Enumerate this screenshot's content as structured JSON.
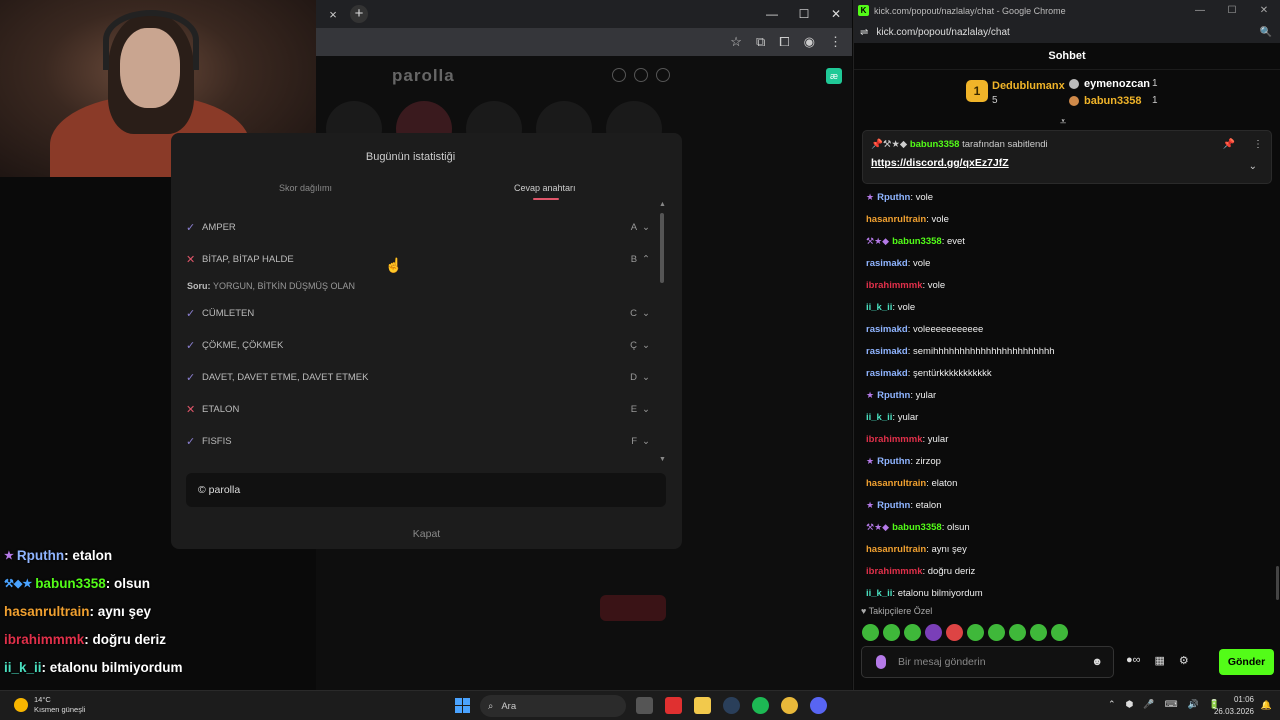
{
  "left_browser": {
    "close_tab_label": "×",
    "new_tab_label": "+",
    "win_minimize": "—",
    "win_maximize": "☐",
    "win_close": "✕",
    "addr_icons": [
      "☆",
      "⧉",
      "⧠",
      "◉",
      "⋮"
    ],
    "site_logo": "parolla",
    "ext_badge": "æ"
  },
  "modal": {
    "title": "Bugünün istatistiği",
    "tabs": [
      "Skor dağılımı",
      "Cevap anahtarı"
    ],
    "active_tab": "Cevap anahtarı",
    "answers": [
      {
        "status": "ok",
        "mark": "✓",
        "word": "AMPER",
        "letter": "A",
        "chevron": "⌄"
      },
      {
        "status": "bad",
        "mark": "✕",
        "word": "BİTAP, BİTAP HALDE",
        "letter": "B",
        "chevron": "⌃"
      },
      {
        "status": "ok",
        "mark": "✓",
        "word": "CÜMLETEN",
        "letter": "C",
        "chevron": "⌄"
      },
      {
        "status": "ok",
        "mark": "✓",
        "word": "ÇÖKME, ÇÖKMEK",
        "letter": "Ç",
        "chevron": "⌄"
      },
      {
        "status": "ok",
        "mark": "✓",
        "word": "DAVET, DAVET ETME, DAVET ETMEK",
        "letter": "D",
        "chevron": "⌄"
      },
      {
        "status": "bad",
        "mark": "✕",
        "word": "ETALON",
        "letter": "E",
        "chevron": "⌄"
      },
      {
        "status": "ok",
        "mark": "✓",
        "word": "FISFIS",
        "letter": "F",
        "chevron": "⌄"
      }
    ],
    "question_label": "Soru:",
    "question_text": "YORGUN, BİTKİN DÜŞMÜŞ OLAN",
    "copyright": "© parolla",
    "close_label": "Kapat",
    "scroll_up": "▲",
    "scroll_down": "▼"
  },
  "overlay_chat": [
    {
      "badge": "★",
      "user": "Rputhn",
      "text": " : etalon",
      "color": "#8fb4ff"
    },
    {
      "badge": "⚒◆★",
      "user": "babun3358",
      "text": " : olsun",
      "color": "#53fc18"
    },
    {
      "badge": "",
      "user": "hasanrultrain",
      "text": " : aynı şey",
      "color": "#f0a030"
    },
    {
      "badge": "",
      "user": "ibrahimmmk",
      "text": " : doğru deriz",
      "color": "#e0304a"
    },
    {
      "badge": "",
      "user": "ii_k_ii",
      "text": " : etalonu bilmiyordum",
      "color": "#4ae0c0"
    }
  ],
  "right_window": {
    "title": "kick.com/popout/nazlalay/chat - Google Chrome",
    "kick_logo": "K",
    "win_minimize": "—",
    "win_maximize": "☐",
    "win_close": "✕",
    "url": "kick.com/popout/nazlalay/chat",
    "url_icon": "⇌",
    "zoom_icon": "🔍",
    "chat_title": "Sohbet",
    "leaderboard": {
      "first": {
        "rank": "1",
        "name": "Dedublumanx",
        "count": "5"
      },
      "second": {
        "name": "eymenozcan",
        "count": "1"
      },
      "third": {
        "name": "babun3358",
        "count": "1"
      },
      "chevron": "⩡"
    },
    "pinned": {
      "by_user": "babun3358",
      "by_suffix": " tarafından sabitlendi",
      "badges": "📌⚒★◆ ",
      "link": "https://discord.gg/qxEz7JfZ",
      "pin_icon": "📌",
      "more_icon": "⋮",
      "expand_icon": "⌄"
    },
    "messages": [
      {
        "badge": "★",
        "user": "Rputhn",
        "text": ": vole",
        "color": "#8fb4ff"
      },
      {
        "badge": "",
        "user": "hasanrultrain",
        "text": ": vole",
        "color": "#f0a030"
      },
      {
        "badge": "⚒★◆",
        "user": "babun3358",
        "text": ": evet",
        "color": "#53fc18"
      },
      {
        "badge": "",
        "user": "rasimakd",
        "text": ": vole",
        "color": "#8fb4ff"
      },
      {
        "badge": "",
        "user": "ibrahimmmk",
        "text": ": vole",
        "color": "#e0304a"
      },
      {
        "badge": "",
        "user": "ii_k_ii",
        "text": ": vole",
        "color": "#4ae0c0"
      },
      {
        "badge": "",
        "user": "rasimakd",
        "text": ": voleeeeeeeeeee",
        "color": "#8fb4ff"
      },
      {
        "badge": "",
        "user": "rasimakd",
        "text": ": semihhhhhhhhhhhhhhhhhhhhhhh",
        "color": "#8fb4ff"
      },
      {
        "badge": "",
        "user": "rasimakd",
        "text": ": şentürkkkkkkkkkkk",
        "color": "#8fb4ff"
      },
      {
        "badge": "★",
        "user": "Rputhn",
        "text": ": yular",
        "color": "#8fb4ff"
      },
      {
        "badge": "",
        "user": "ii_k_ii",
        "text": ": yular",
        "color": "#4ae0c0"
      },
      {
        "badge": "",
        "user": "ibrahimmmk",
        "text": ": yular",
        "color": "#e0304a"
      },
      {
        "badge": "★",
        "user": "Rputhn",
        "text": ": zirzop",
        "color": "#8fb4ff"
      },
      {
        "badge": "",
        "user": "hasanrultrain",
        "text": ": elaton",
        "color": "#f0a030"
      },
      {
        "badge": "★",
        "user": "Rputhn",
        "text": ": etalon",
        "color": "#8fb4ff"
      },
      {
        "badge": "⚒★◆",
        "user": "babun3358",
        "text": ": olsun",
        "color": "#53fc18"
      },
      {
        "badge": "",
        "user": "hasanrultrain",
        "text": ": aynı şey",
        "color": "#f0a030"
      },
      {
        "badge": "",
        "user": "ibrahimmmk",
        "text": ": doğru deriz",
        "color": "#e0304a"
      },
      {
        "badge": "",
        "user": "ii_k_ii",
        "text": ": etalonu bilmiyordum",
        "color": "#4ae0c0"
      }
    ],
    "follow_only": "♥ Takipçilere Özel",
    "input_placeholder": "Bir mesaj gönderin",
    "emoji_icon": "☻",
    "tools": [
      "●∞",
      "▦",
      "⚙"
    ],
    "send_label": "Gönder"
  },
  "taskbar": {
    "temperature": "14°C",
    "weather": "Kısmen güneşli",
    "search_label": "Ara",
    "search_icon": "⌕",
    "tray": [
      "⌃",
      "⬢",
      "🎤",
      "⌨",
      "🔊",
      "🔋"
    ],
    "time": "01:06",
    "date": "26.03.2026",
    "bell_icon": "🔔"
  }
}
